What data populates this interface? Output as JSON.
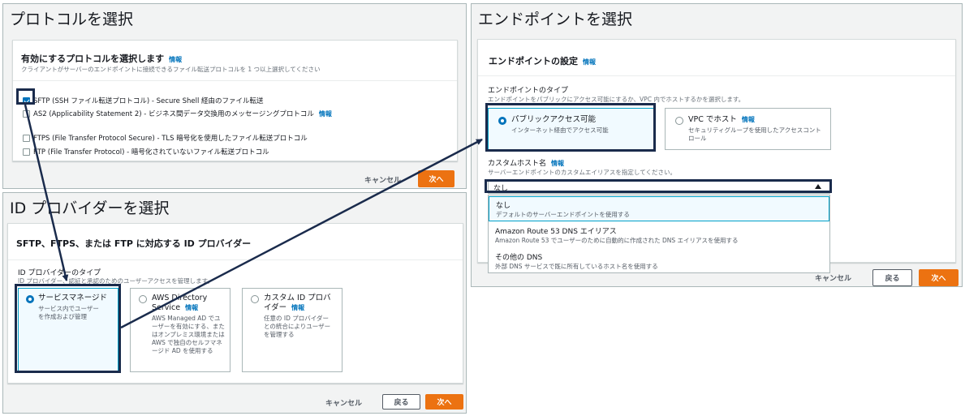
{
  "protocol_panel": {
    "title": "プロトコルを選択",
    "card_title": "有効にするプロトコルを選択します",
    "info": "情報",
    "description": "クライアントがサーバーのエンドポイントに接続できるファイル転送プロトコルを 1 つ以上選択してください",
    "options": [
      {
        "label": "SFTP (SSH ファイル転送プロトコル) - Secure Shell 経由のファイル転送",
        "checked": true
      },
      {
        "label": "AS2 (Applicability Statement 2) - ビジネス間データ交換用のメッセージングプロトコル",
        "checked": false,
        "info": "情報"
      },
      {
        "label": "FTPS (File Transfer Protocol Secure) - TLS 暗号化を使用したファイル転送プロトコル",
        "checked": false
      },
      {
        "label": "FTP (File Transfer Protocol) - 暗号化されていないファイル転送プロトコル",
        "checked": false
      }
    ],
    "cancel": "キャンセル",
    "next": "次へ"
  },
  "idp_panel": {
    "title": "ID プロバイダーを選択",
    "card_title": "SFTP、FTPS、または FTP に対応する ID プロバイダー",
    "type_label": "ID プロバイダーのタイプ",
    "type_desc": "ID プロバイダー、認証と承認のためのユーザーアクセスを管理します。",
    "tiles": [
      {
        "title": "サービスマネージド",
        "desc": "サービス内でユーザーを作成および管理",
        "selected": true
      },
      {
        "title": "AWS Directory Service",
        "info": "情報",
        "desc": "AWS Managed AD でユーザーを有効にする、またはオンプレミス環境または AWS で独自のセルフマネージド AD を使用する",
        "selected": false
      },
      {
        "title": "カスタム ID プロバイダー",
        "info": "情報",
        "desc": "任意の ID プロバイダーとの統合によりユーザーを管理する",
        "selected": false
      }
    ],
    "cancel": "キャンセル",
    "back": "戻る",
    "next": "次へ"
  },
  "endpoint_panel": {
    "title": "エンドポイントを選択",
    "card_title": "エンドポイントの設定",
    "info": "情報",
    "type_label": "エンドポイントのタイプ",
    "type_desc": "エンドポイントをパブリックにアクセス可能にするか、VPC 内でホストするかを選択します。",
    "tiles": [
      {
        "title": "パブリックアクセス可能",
        "desc": "インターネット経由でアクセス可能",
        "selected": true
      },
      {
        "title": "VPC でホスト",
        "info": "情報",
        "desc": "セキュリティグループを使用したアクセスコントロール",
        "selected": false
      }
    ],
    "hostname_label": "カスタムホスト名",
    "hostname_info": "情報",
    "hostname_desc": "サーバーエンドポイントのカスタムエイリアスを指定してください。",
    "select_value": "なし",
    "dropdown": [
      {
        "title": "なし",
        "desc": "デフォルトのサーバーエンドポイントを使用する"
      },
      {
        "title": "Amazon Route 53 DNS エイリアス",
        "desc": "Amazon Route 53 でユーザーのために自動的に作成された DNS エイリアスを使用する"
      },
      {
        "title": "その他の DNS",
        "desc": "外部 DNS サービスで既に所有しているホスト名を使用する"
      }
    ],
    "cancel": "キャンセル",
    "back": "戻る",
    "next": "次へ"
  },
  "colors": {
    "accent": "#0073bb",
    "primary_button": "#ec7211",
    "highlight_box": "#1a2b4c",
    "selected_tile": "#f1faff"
  }
}
